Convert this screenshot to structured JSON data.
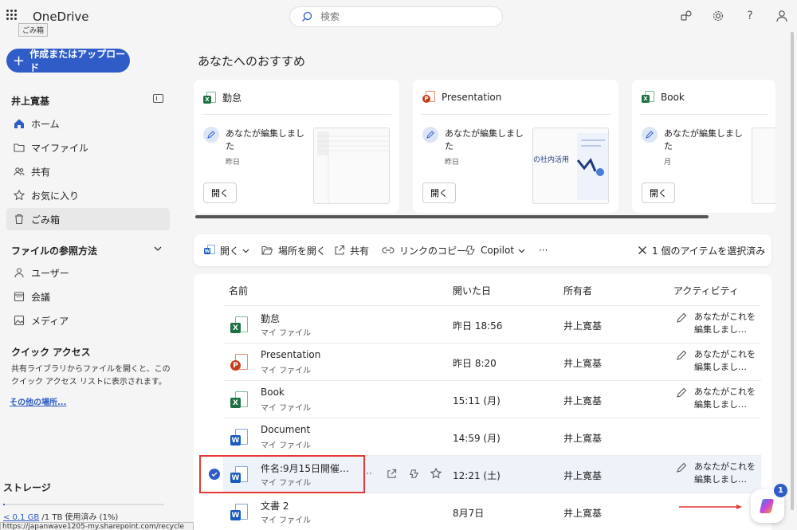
{
  "app": {
    "title": "OneDrive",
    "tooltip": "ごみ箱"
  },
  "search": {
    "placeholder": "検索"
  },
  "topbar": {
    "help": "?"
  },
  "sidebar": {
    "create_label": "作成またはアップロード",
    "user_name": "井上寛基",
    "items": [
      {
        "label": "ホーム",
        "icon": "home-icon"
      },
      {
        "label": "マイファイル",
        "icon": "folder-icon"
      },
      {
        "label": "共有",
        "icon": "people-icon"
      },
      {
        "label": "お気に入り",
        "icon": "star-icon"
      },
      {
        "label": "ごみ箱",
        "icon": "trash-icon"
      }
    ],
    "browse_title": "ファイルの参照方法",
    "browse_items": [
      {
        "label": "ユーザー",
        "icon": "person-icon"
      },
      {
        "label": "会議",
        "icon": "calendar-icon"
      },
      {
        "label": "メディア",
        "icon": "image-icon"
      }
    ],
    "quick_title": "クイック アクセス",
    "quick_desc": "共有ライブラリからファイルを開くと、このクイック アクセス リストに表示されます。",
    "other_link": "その他の場所...",
    "storage_title": "ストレージ",
    "storage_used": "< 0.1 GB",
    "storage_rest": " /1 TB 使用済み (1%)",
    "storage_percent": 1,
    "status_url": "https://japanwave1205-my.sharepoint.com/recycle"
  },
  "recommendations": {
    "title": "あなたへのおすすめ",
    "cards": [
      {
        "name": "勤怠",
        "type": "xl",
        "message": "あなたが編集しました",
        "time": "昨日",
        "open": "開く"
      },
      {
        "name": "Presentation",
        "type": "pp",
        "message": "あなたが編集しました",
        "time": "昨日",
        "open": "開く",
        "thumb_text": "の社内活用"
      },
      {
        "name": "Book",
        "type": "xl",
        "message": "あなたが編集しました",
        "time": "月",
        "open": "開く"
      }
    ]
  },
  "toolbar": {
    "open": "開く",
    "open_location": "場所を開く",
    "share": "共有",
    "copy_link": "リンクのコピー",
    "copilot": "Copilot",
    "more": "···",
    "selection": "1 個のアイテムを選択済み"
  },
  "list": {
    "headers": {
      "name": "名前",
      "opened": "開いた日",
      "owner": "所有者",
      "activity": "アクティビティ"
    },
    "rows": [
      {
        "name": "勤怠",
        "type": "xl",
        "location": "マイ ファイル",
        "date": "昨日 18:56",
        "owner": "井上寛基",
        "activity": "あなたがこれを編集しまし…"
      },
      {
        "name": "Presentation",
        "type": "pp",
        "location": "マイ ファイル",
        "date": "昨日 8:20",
        "owner": "井上寛基",
        "activity": "あなたがこれを編集しまし…"
      },
      {
        "name": "Book",
        "type": "xl",
        "location": "マイ ファイル",
        "date": "15:11 (月)",
        "owner": "井上寛基",
        "activity": "あなたがこれを編集しまし…"
      },
      {
        "name": "Document",
        "type": "wd",
        "location": "マイ ファイル",
        "date": "14:59 (月)",
        "owner": "井上寛基",
        "activity": ""
      },
      {
        "name": "件名:9月15日開催…",
        "type": "wd",
        "location": "マイ ファイル",
        "date": "12:21 (土)",
        "owner": "井上寛基",
        "activity": "あなたがこれを編集しまし…",
        "selected": true
      },
      {
        "name": "文書 2",
        "type": "wd",
        "location": "マイ ファイル",
        "date": "8月7日",
        "owner": "井上寛基",
        "activity": ""
      }
    ]
  },
  "copilot": {
    "badge": "1"
  },
  "colors": {
    "accent": "#2f5cc6",
    "excel": "#1e7145",
    "powerpoint": "#c43e1c",
    "word": "#185abd",
    "highlight": "#e53935"
  }
}
